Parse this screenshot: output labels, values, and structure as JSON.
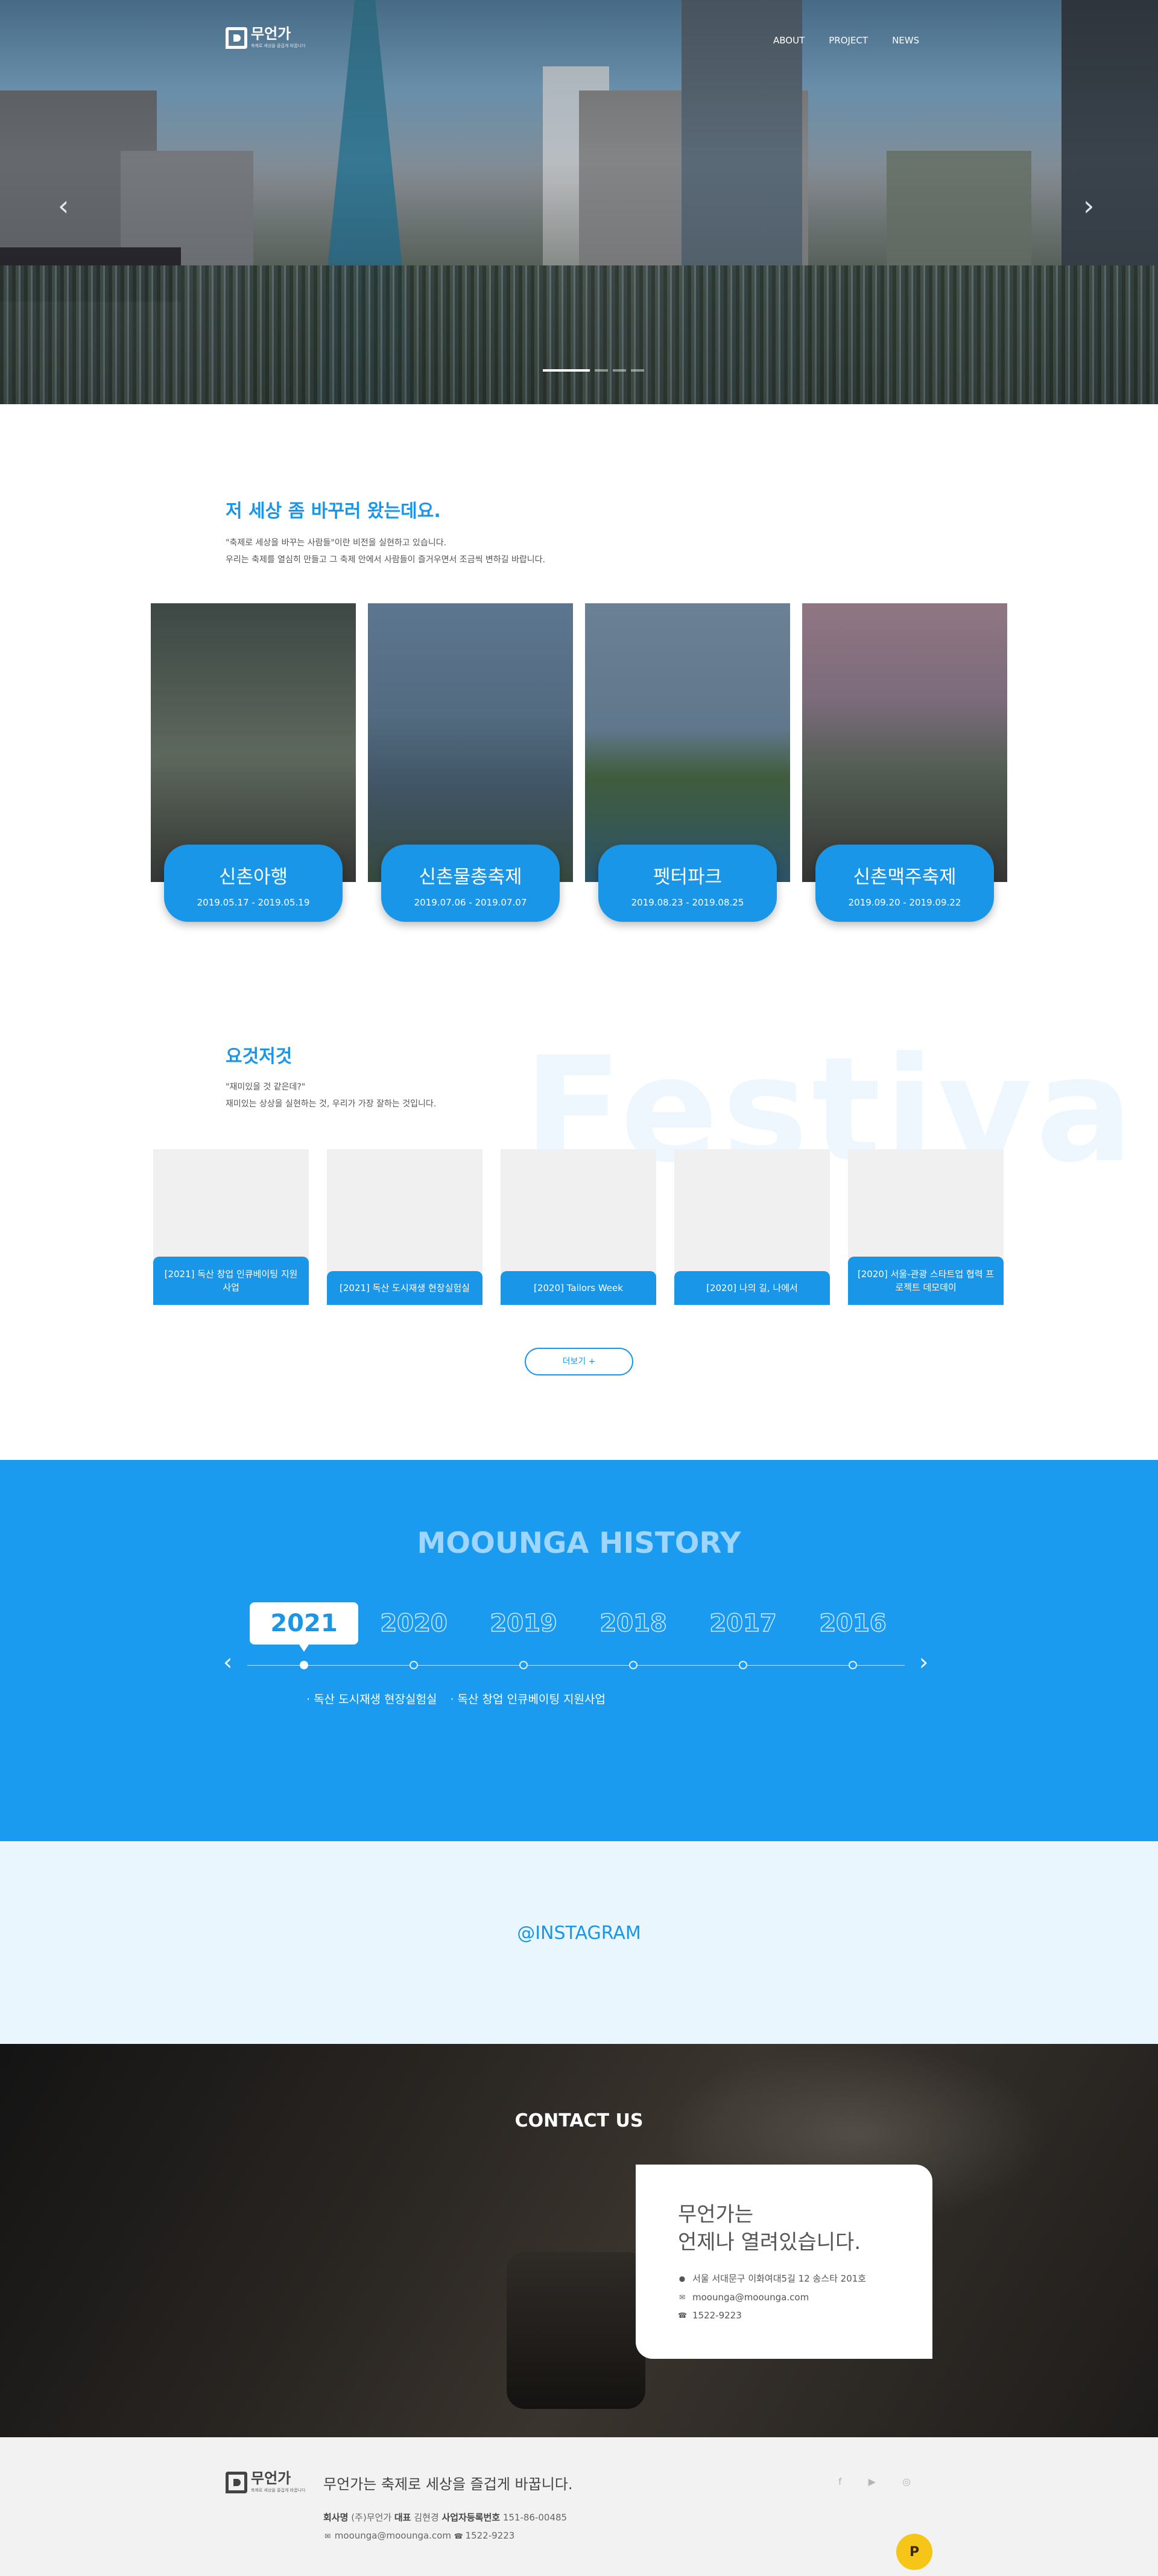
{
  "brand": {
    "name": "무언가",
    "tagline": "축제로 세상을 즐겁게 바꿉니다"
  },
  "nav": {
    "items": [
      "ABOUT",
      "PROJECT",
      "NEWS"
    ]
  },
  "hero": {
    "prev": "‹",
    "next": "›",
    "slides": 5,
    "active_slide": 1
  },
  "intro": {
    "title": "저 세상 좀 바꾸러 왔는데요.",
    "desc1": "\"축제로 세상을 바꾸는 사람들\"이란 비전을 실현하고 있습니다.",
    "desc2": "우리는 축제를 열심히 만들고 그 축제 안에서 사람들이 즐거우면서 조금씩 변하길 바랍니다."
  },
  "festivals": [
    {
      "name": "신촌아행",
      "date": "2019.05.17 - 2019.05.19"
    },
    {
      "name": "신촌물총축제",
      "date": "2019.07.06 - 2019.07.07"
    },
    {
      "name": "펫터파크",
      "date": "2019.08.23 - 2019.08.25"
    },
    {
      "name": "신촌맥주축제",
      "date": "2019.09.20 - 2019.09.22"
    }
  ],
  "projects_section": {
    "title": "요것저것",
    "desc1": "\"재미있을 것 같은데?\"",
    "desc2": "재미있는 상상을 실현하는 것, 우리가 가장 잘하는 것입니다.",
    "watermark": "Festiva",
    "more_label": "더보기 +"
  },
  "projects": [
    "[2021] 독산 창업 인큐베이팅 지원사업",
    "[2021] 독산 도시재생 현장실험실",
    "[2020] Tailors Week",
    "[2020] 나의 길, 나에서",
    "[2020] 서울-관광 스타트업 협력 프로젝트 데모데이"
  ],
  "history": {
    "title": "MOOUNGA HISTORY",
    "years": [
      "2021",
      "2020",
      "2019",
      "2018",
      "2017",
      "2016"
    ],
    "active_year": "2021",
    "prev": "‹",
    "next": "›",
    "items": [
      "· 독산 도시재생 현장실험실",
      "· 독산 창업 인큐베이팅 지원사업"
    ]
  },
  "instagram": {
    "title": "@INSTAGRAM"
  },
  "contact": {
    "title": "CONTACT US",
    "line1": "무언가는",
    "line2": "언제나 열려있습니다.",
    "address": "서울 서대문구 이화여대5길 12 송스타 201호",
    "email": "moounga@moounga.com",
    "phone": "1522-9223"
  },
  "footer": {
    "slogan": "무언가는 축제로 세상을 즐겁게 바꿉니다.",
    "company_label": "회사명",
    "company": "(주)무언가",
    "ceo_label": "대표",
    "ceo": "김현경",
    "biz_label": "사업자등록번호",
    "biz_no": "151-86-00485",
    "email": "moounga@moounga.com",
    "phone": "1522-9223",
    "social_icons": [
      "facebook-icon",
      "youtube-icon",
      "instagram-icon"
    ],
    "kakao_label": "P"
  },
  "colors": {
    "accent": "#1a96e8",
    "history_bg": "#1a9bf0",
    "insta_bg": "#eaf6fd",
    "footer_bg": "#f2f2f2"
  }
}
